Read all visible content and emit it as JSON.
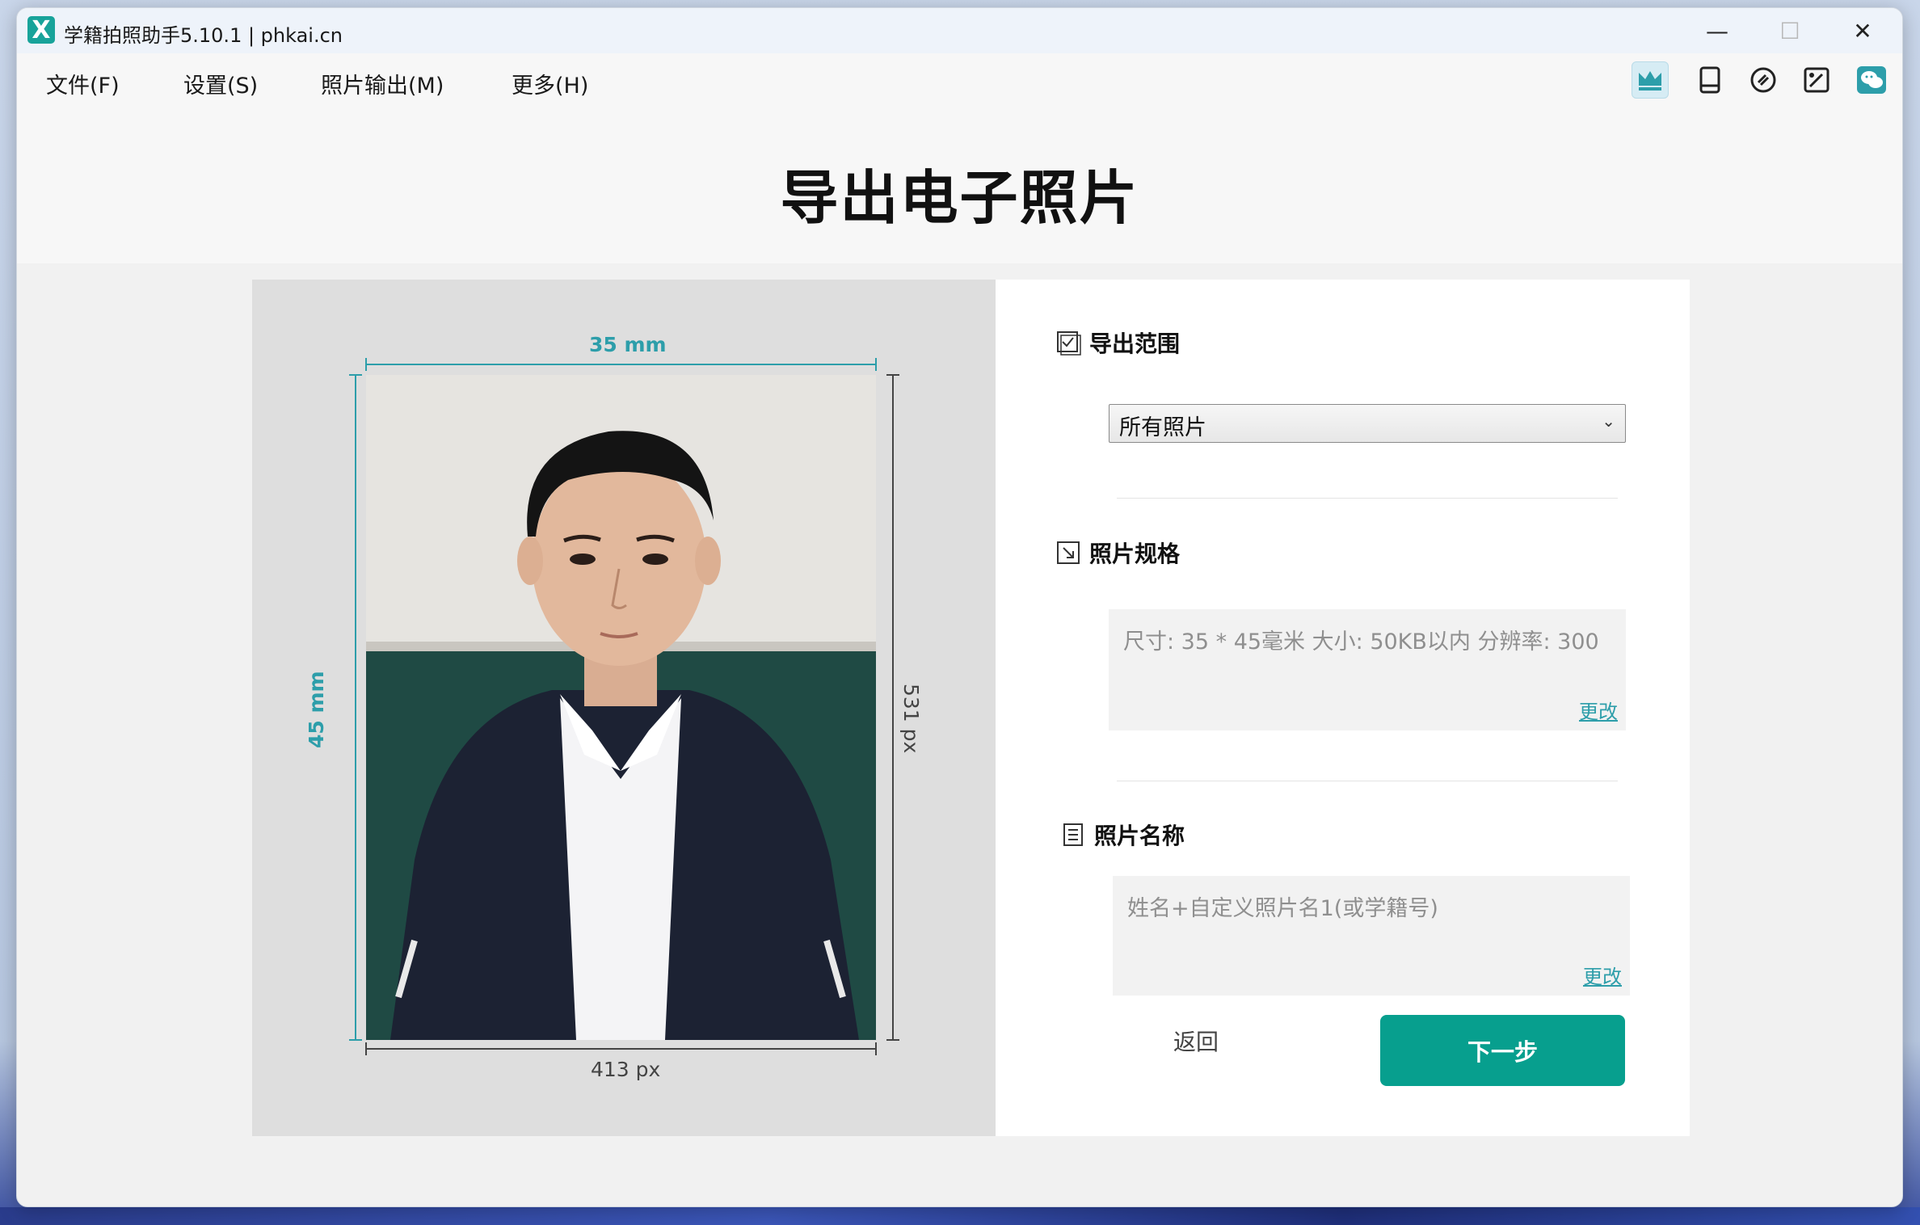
{
  "window": {
    "title": "学籍拍照助手5.10.1 | phkai.cn",
    "logo_glyph": "X",
    "minimize_glyph": "—",
    "maximize_glyph": "☐",
    "close_glyph": "✕"
  },
  "menu": {
    "items": [
      {
        "label": "文件(F)"
      },
      {
        "label": "设置(S)"
      },
      {
        "label": "照片输出(M)"
      },
      {
        "label": "更多(H)"
      }
    ]
  },
  "toolbar": {
    "icons": [
      "crown-icon",
      "tablet-icon",
      "link-icon",
      "image-edit-icon",
      "wechat-icon"
    ],
    "active_icon": "crown-icon",
    "accent_color": "#2d9eaa"
  },
  "page": {
    "title": "导出电子照片"
  },
  "preview": {
    "width_mm_label": "35 mm",
    "height_mm_label": "45 mm",
    "width_px_label": "413 px",
    "height_px_label": "531 px"
  },
  "settings": {
    "export_range": {
      "heading": "导出范围",
      "selected": "所有照片"
    },
    "photo_spec": {
      "heading": "照片规格",
      "text": "尺寸: 35 * 45毫米  大小: 50KB以内  分辨率:  300",
      "link": "更改"
    },
    "photo_name": {
      "heading": "照片名称",
      "text": "姓名+自定义照片名1(或学籍号)",
      "link": "更改"
    },
    "back_label": "返回",
    "next_label": "下一步",
    "primary_color": "#079f8e"
  }
}
